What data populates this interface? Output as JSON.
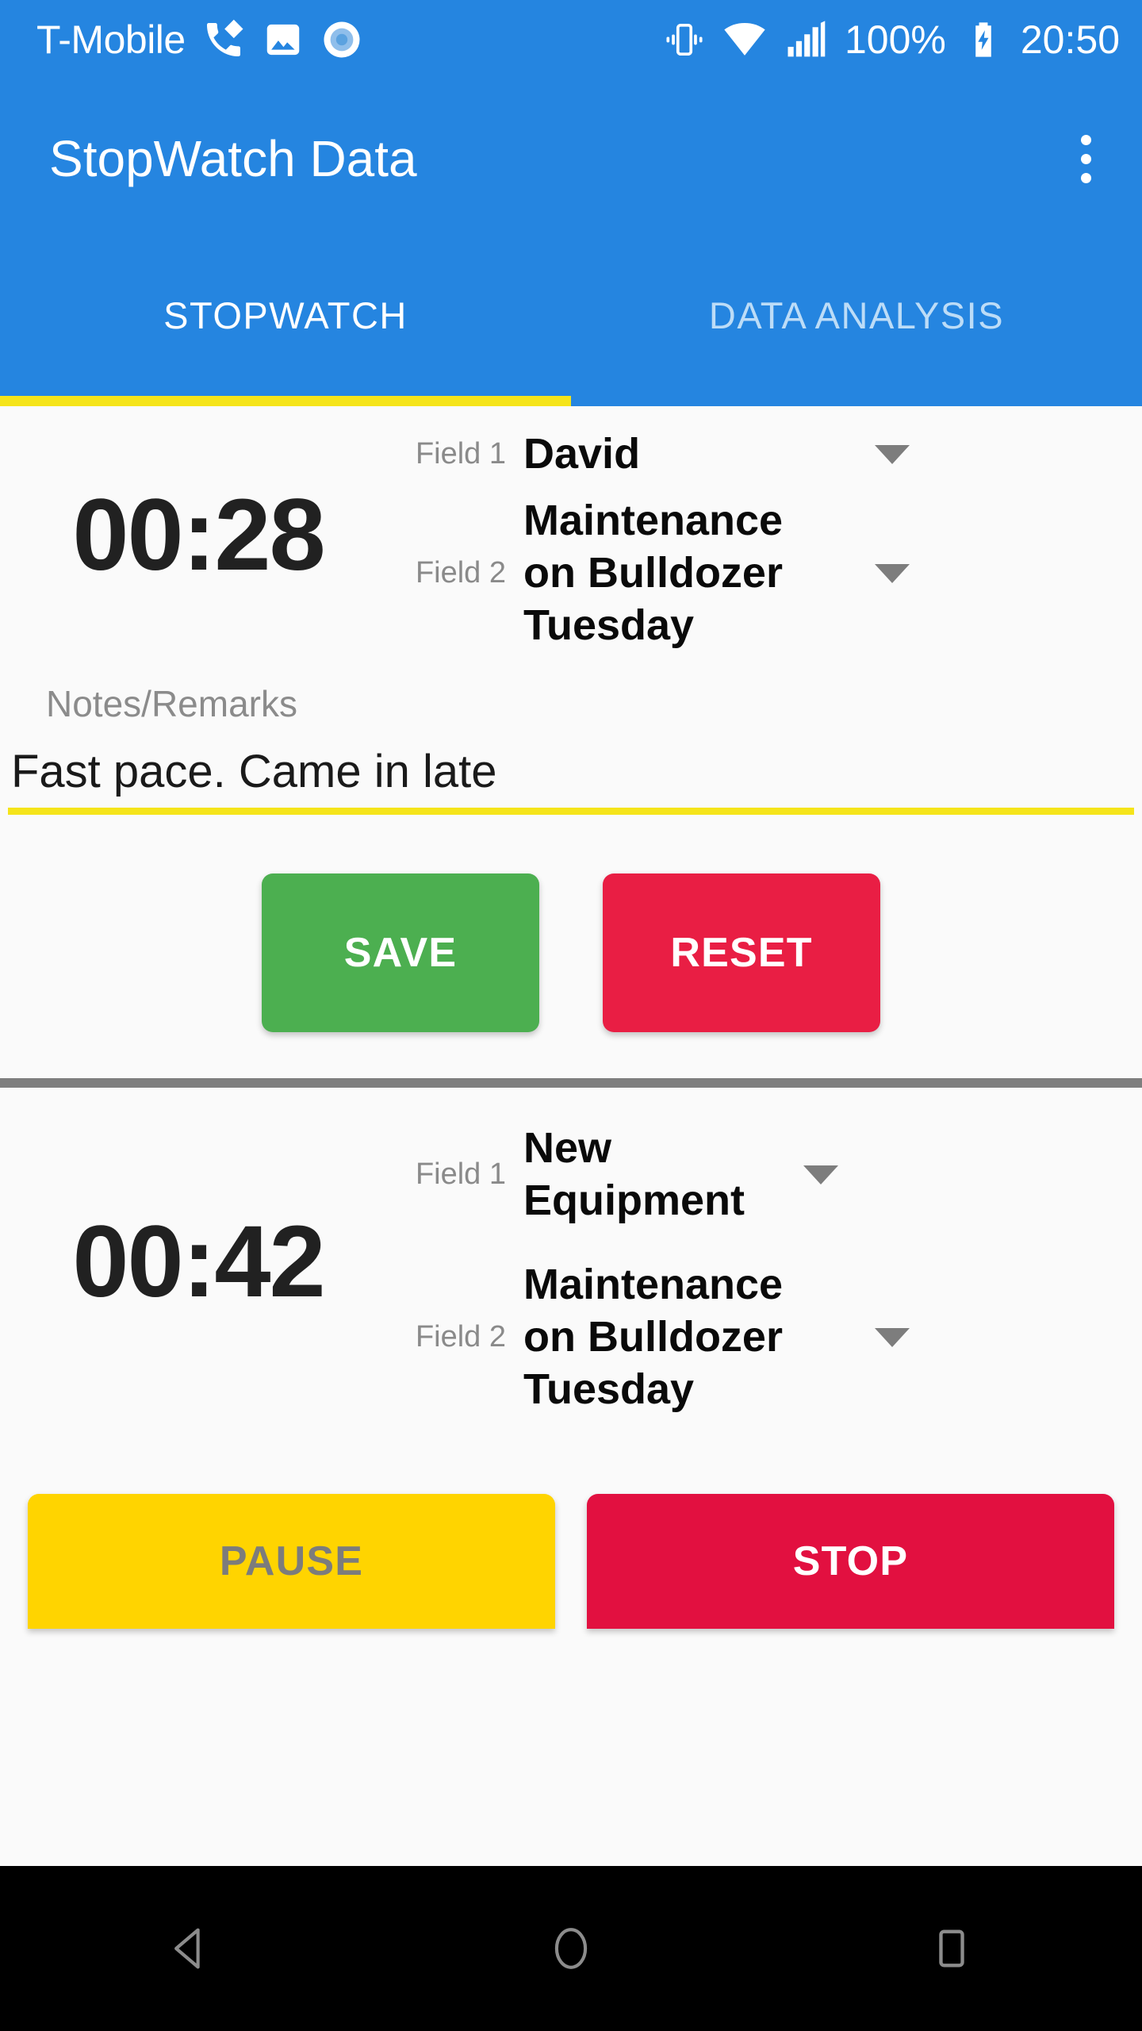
{
  "status_bar": {
    "carrier": "T-Mobile",
    "battery_percent": "100%",
    "clock": "20:50",
    "icons": {
      "wifi_calling": "wifi-calling-icon",
      "screenshot": "image-icon",
      "assistant": "circle-record-icon",
      "vibrate": "vibrate-icon",
      "wifi": "wifi-icon",
      "signal": "cellular-signal-icon",
      "battery": "battery-charging-icon"
    }
  },
  "app_bar": {
    "title": "StopWatch Data",
    "overflow_label": "more-options"
  },
  "tabs": [
    {
      "label": "STOPWATCH",
      "active": true
    },
    {
      "label": "DATA ANALYSIS",
      "active": false
    }
  ],
  "theme": {
    "primary": "#2585e0",
    "accent_yellow": "#f5e41a",
    "save_green": "#4caf50",
    "reset_red": "#e91e44",
    "pause_yellow": "#ffd400",
    "stop_red": "#e21040",
    "background": "#fafafa",
    "label_gray": "#8a8a8a"
  },
  "cards": [
    {
      "name": "saved-entry-card",
      "timer": "00:28",
      "fields": [
        {
          "label": "Field 1",
          "value": "David"
        },
        {
          "label": "Field 2",
          "value": "Maintenance on Bulldozer Tuesday"
        }
      ],
      "notes": {
        "label": "Notes/Remarks",
        "value": "Fast pace. Came in late",
        "placeholder": "Notes/Remarks"
      },
      "buttons": [
        {
          "label": "SAVE",
          "style": "save"
        },
        {
          "label": "RESET",
          "style": "reset"
        }
      ]
    },
    {
      "name": "running-entry-card",
      "timer": "00:42",
      "fields": [
        {
          "label": "Field 1",
          "value": "New Equipment"
        },
        {
          "label": "Field 2",
          "value": "Maintenance on Bulldozer Tuesday"
        }
      ],
      "buttons": [
        {
          "label": "PAUSE",
          "style": "pause"
        },
        {
          "label": "STOP",
          "style": "stop"
        }
      ]
    }
  ],
  "nav_bar": {
    "back": "back-triangle-icon",
    "home": "home-circle-icon",
    "recents": "recents-square-icon"
  }
}
